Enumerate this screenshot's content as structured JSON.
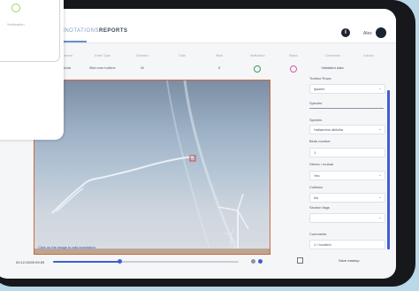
{
  "header": {
    "tabs": [
      {
        "label": "ANNOTATIONS",
        "active": true
      },
      {
        "label": "REPORTS",
        "active": false
      }
    ],
    "user_name": "Alex"
  },
  "metadata": [
    {
      "label": "Observer",
      "value": "Linda"
    },
    {
      "label": "Event Type",
      "value": "Bird over turbine"
    },
    {
      "label": "Direction",
      "value": "W"
    },
    {
      "label": "Date",
      "value": ""
    },
    {
      "label": "Wind",
      "value": "5"
    },
    {
      "label": "Verification",
      "value": "",
      "status": "green"
    },
    {
      "label": "Status",
      "value": "",
      "status": "pink"
    },
    {
      "label": "Comments",
      "value": "Validated data"
    },
    {
      "label": "Actions",
      "value": ""
    }
  ],
  "photo": {
    "caption": "Click on the image to add annotation"
  },
  "playback": {
    "timecode": "00:12:26/00:59:59",
    "progress": 0.36,
    "save_label": "Save markup"
  },
  "panel": {
    "turbine_rows_label": "Turbine Rows",
    "turbine_rows_value": "Ijsselm",
    "species_section": "Species",
    "species_label": "Species",
    "species_value": "Haliaeetus albicilla",
    "birds_number_label": "Birds number",
    "birds_number_value": "1",
    "stereo_label": "Stereo / mutual",
    "stereo_value": "Yes",
    "collision_label": "Collision",
    "collision_value": "No",
    "section_flags_label": "Section flags",
    "section_flags_value": "",
    "comments_label": "Comments",
    "comments_value": "1 / Incident"
  },
  "overlay": {
    "label": "Verification"
  }
}
